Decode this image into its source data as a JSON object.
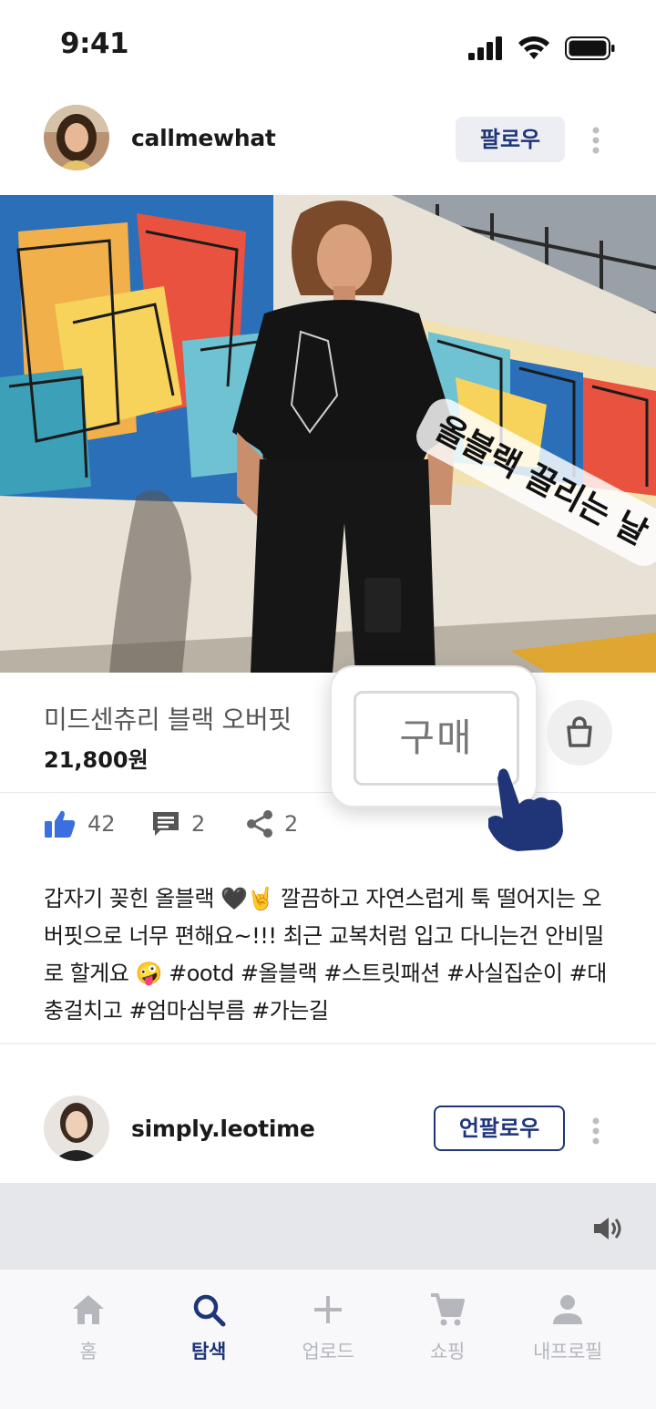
{
  "status_bar": {
    "time": "9:41"
  },
  "post1": {
    "username": "callmewhat",
    "follow_label": "팔로우",
    "sticker_text": "올블랙 끌리는 날 🖤",
    "product_name": "미드센츄리 블랙 오버핏",
    "product_price": "21,800원",
    "buy_label": "구매",
    "likes": "42",
    "comments": "2",
    "shares": "2",
    "caption": "갑자기 꽂힌 올블랙 🖤🤘 깔끔하고 자연스럽게 툭 떨어지는 오버핏으로 너무 편해요~!!! 최근 교복처럼 입고 다니는건 안비밀로 할게요 🤪 #ootd #올블랙 #스트릿패션 #사실집순이 #대충걸치고 #엄마심부름 #가는길"
  },
  "post2": {
    "username": "simply.leotime",
    "unfollow_label": "언팔로우"
  },
  "bottom_nav": {
    "items": [
      {
        "label": "홈",
        "icon": "home-icon",
        "active": false
      },
      {
        "label": "탐색",
        "icon": "search-icon",
        "active": true
      },
      {
        "label": "업로드",
        "icon": "plus-icon",
        "active": false
      },
      {
        "label": "쇼핑",
        "icon": "cart-icon",
        "active": false
      },
      {
        "label": "내프로필",
        "icon": "profile-icon",
        "active": false
      }
    ]
  },
  "colors": {
    "accent": "#1f3578",
    "like": "#3b6fe0",
    "inactive": "#b5b7bd"
  }
}
